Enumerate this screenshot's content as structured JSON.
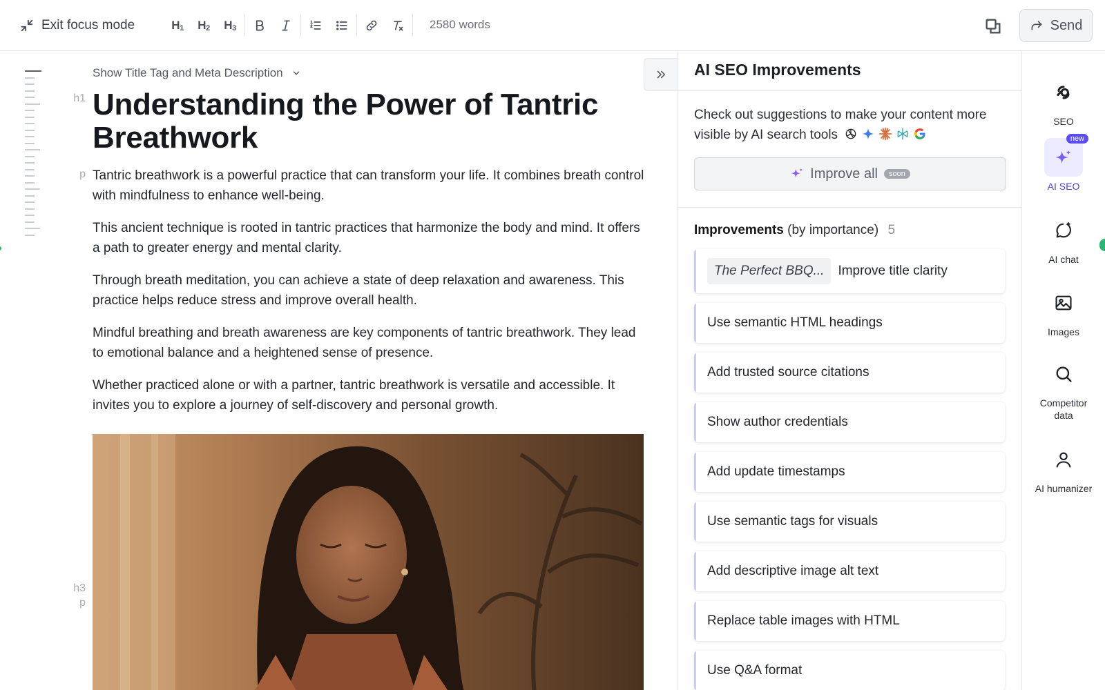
{
  "toolbar": {
    "exit_label": "Exit focus mode",
    "h1": "H",
    "h1_sub": "1",
    "h2": "H",
    "h2_sub": "2",
    "h3": "H",
    "h3_sub": "3",
    "word_count": "2580 words",
    "send_label": "Send"
  },
  "editor": {
    "show_title_label": "Show Title Tag and Meta Description",
    "tag_h1": "h1",
    "tag_p": "p",
    "tag_h3": "h3",
    "tag_p2": "p",
    "title": "Understanding the Power of Tantric Breathwork",
    "paragraphs": [
      "Tantric breathwork is a powerful practice that can transform your life. It combines breath control with mindfulness to enhance well-being.",
      "This ancient technique is rooted in tantric practices that harmonize the body and mind. It offers a path to greater energy and mental clarity.",
      "Through breath meditation, you can achieve a state of deep relaxation and awareness. This practice helps reduce stress and improve overall health.",
      "Mindful breathing and breath awareness are key components of tantric breathwork. They lead to emotional balance and a heightened sense of presence.",
      "Whether practiced alone or with a partner, tantric breathwork is versatile and accessible. It invites you to explore a journey of self-discovery and personal growth."
    ]
  },
  "panel": {
    "title": "AI SEO Improvements",
    "intro": "Check out suggestions to make your content more visible by AI search tools",
    "improve_all": "Improve all",
    "soon": "soon",
    "improvements_bold": "Improvements",
    "improvements_rest": "(by importance)",
    "count": "5",
    "first_chip": "The Perfect BBQ...",
    "items": [
      "Improve title clarity",
      "Use semantic HTML headings",
      "Add trusted source citations",
      "Show author credentials",
      "Add update timestamps",
      "Use semantic tags for visuals",
      "Add descriptive image alt text",
      "Replace table images with HTML",
      "Use Q&A format"
    ]
  },
  "rail": {
    "seo": "SEO",
    "ai_seo": "AI SEO",
    "new_badge": "new",
    "ai_chat": "AI chat",
    "images": "Images",
    "competitor_line1": "Competitor",
    "competitor_line2": "data",
    "humanizer": "AI humanizer"
  },
  "colors": {
    "accent": "#4a46d9",
    "badge": "#5b4df3",
    "green": "#2bb673",
    "card_border": "#c7d0f3"
  }
}
